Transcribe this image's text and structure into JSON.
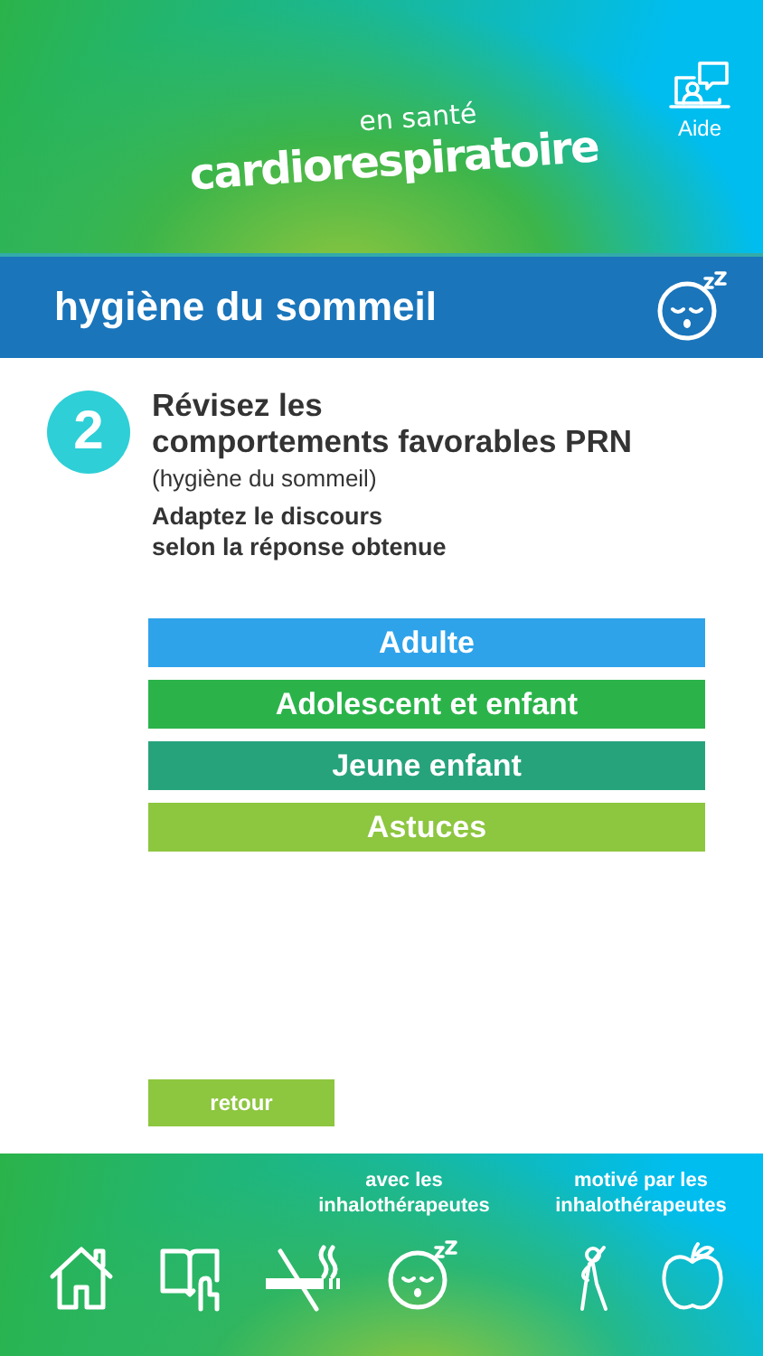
{
  "header": {
    "logo": {
      "top": "en santé",
      "main": "cardiorespiratoire"
    },
    "help": {
      "label": "Aide"
    }
  },
  "title_bar": {
    "title": "hygiène du sommeil"
  },
  "step": {
    "number": "2",
    "title": "Révisez les\ncomportements favorables PRN",
    "subtitle": "(hygiène du sommeil)",
    "instruction": "Adaptez le discours\nselon la réponse obtenue"
  },
  "options": [
    {
      "label": "Adulte",
      "color": "#2fa3ea"
    },
    {
      "label": "Adolescent et enfant",
      "color": "#2bb34a"
    },
    {
      "label": "Jeune enfant",
      "color": "#27a37c"
    },
    {
      "label": "Astuces",
      "color": "#8dc63f"
    }
  ],
  "back_button": {
    "label": "retour"
  },
  "footer": {
    "captions": [
      "avec les inhalothérapeutes",
      "motivé par les inhalothérapeutes"
    ],
    "nav": [
      {
        "kind": "home"
      },
      {
        "kind": "book"
      },
      {
        "kind": "smoking"
      },
      {
        "kind": "sleep"
      },
      {
        "kind": "exercise"
      },
      {
        "kind": "apple"
      }
    ]
  }
}
